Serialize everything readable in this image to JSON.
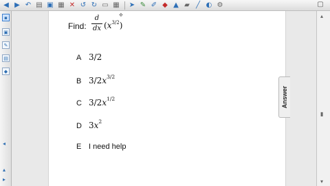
{
  "toolbar": {
    "icons": [
      "arrow-left-icon",
      "arrow-right-icon",
      "reply-icon",
      "layout-icon",
      "save-icon",
      "paste-icon",
      "delete-icon",
      "undo-icon",
      "redo-icon",
      "screen-icon",
      "table-icon",
      "select-icon",
      "pen-icon",
      "highlighter-icon",
      "shape-icon",
      "text-icon",
      "eraser-icon",
      "line-icon",
      "fill-icon",
      "properties-icon"
    ]
  },
  "question": {
    "label": "Find:",
    "derivative_numerator": "d",
    "derivative_denominator": "dx",
    "expression_open": "(",
    "expression_var": "x",
    "expression_exponent": "3/2",
    "expression_close": ")"
  },
  "choices": [
    {
      "letter": "A",
      "text": "3/2"
    },
    {
      "letter": "B",
      "prefix": "3/2",
      "var": "x",
      "exponent": "3/2"
    },
    {
      "letter": "C",
      "prefix": "3/2",
      "var": "x",
      "exponent": "1/2"
    },
    {
      "letter": "D",
      "prefix": "3",
      "var": "x",
      "exponent": "2"
    },
    {
      "letter": "E",
      "text": "I need help"
    }
  ],
  "answer_tab": {
    "label": "Answer"
  }
}
